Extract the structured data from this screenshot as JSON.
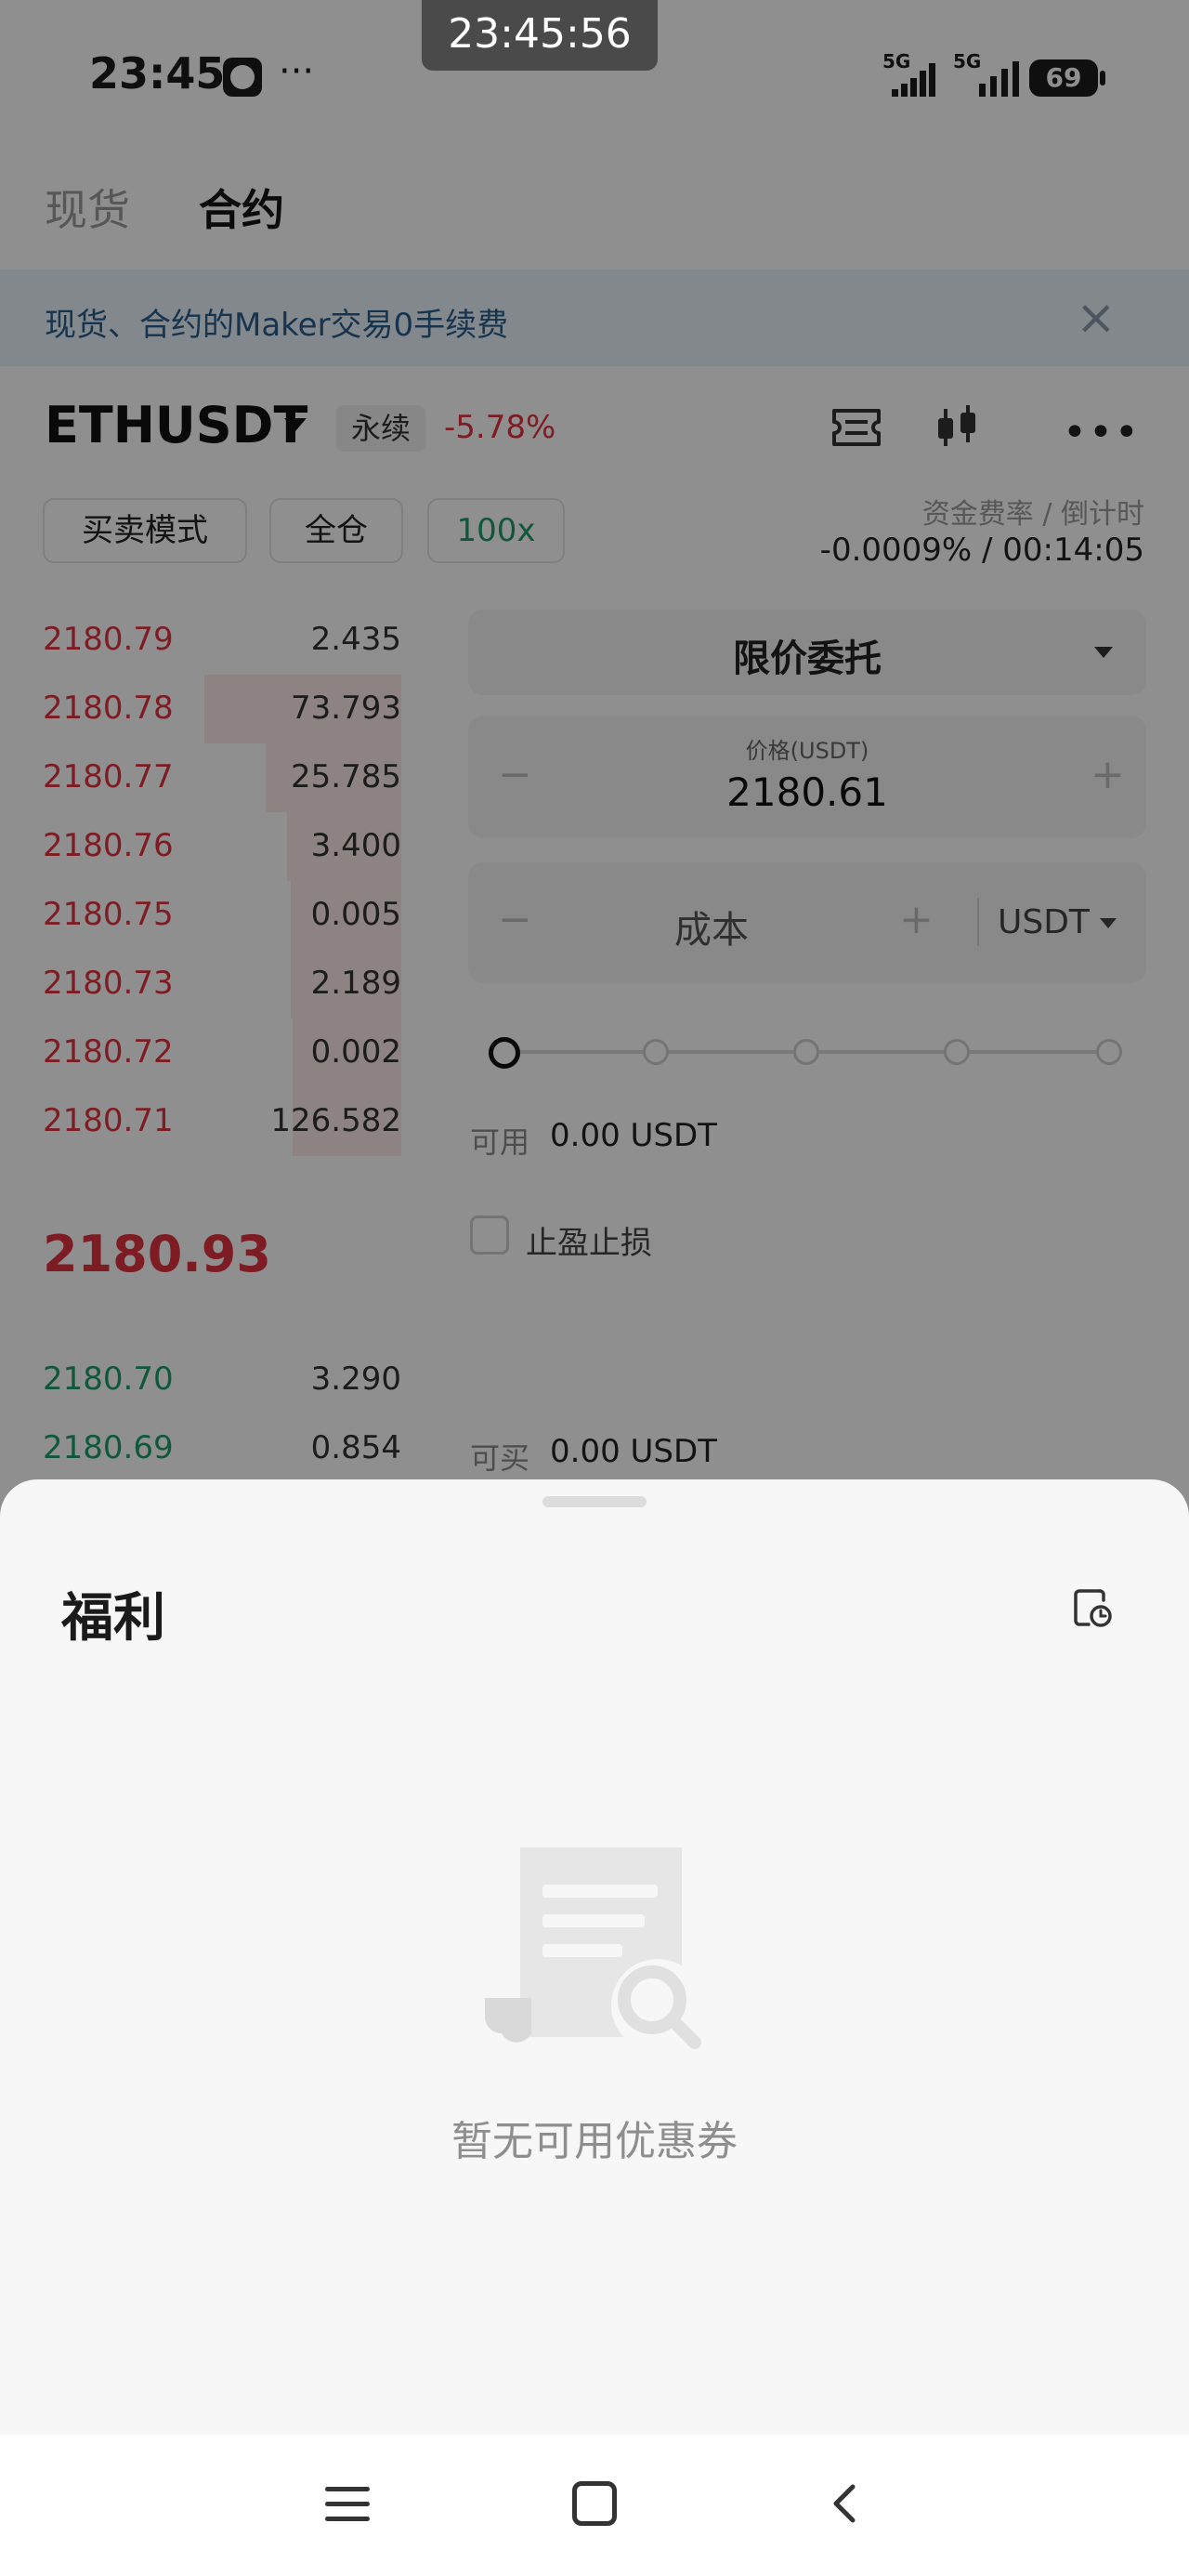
{
  "overlay": {
    "screen_time": "23:45:56"
  },
  "status_bar": {
    "time": "23:45",
    "dots": "···",
    "network_1": "5G",
    "network_2": "5G",
    "battery": "69"
  },
  "tabs": {
    "spot": "现货",
    "futures": "合约"
  },
  "banner": {
    "text": "现货、合约的Maker交易0手续费",
    "close": "×"
  },
  "pair": {
    "name": "ETHUSDT",
    "badge": "永续",
    "change": "-5.78%",
    "more": "•••"
  },
  "mode_buttons": {
    "trading_mode": "买卖模式",
    "margin": "全仓",
    "leverage": "100x"
  },
  "funding": {
    "label": "资金费率 / 倒计时",
    "value": "-0.0009% / 00:14:05"
  },
  "order_book": {
    "asks": [
      {
        "price": "2180.79",
        "qty": "2.435",
        "depth": 0.0
      },
      {
        "price": "2180.78",
        "qty": "73.793",
        "depth": 1.0
      },
      {
        "price": "2180.77",
        "qty": "25.785",
        "depth": 0.69
      },
      {
        "price": "2180.76",
        "qty": "3.400",
        "depth": 0.58
      },
      {
        "price": "2180.75",
        "qty": "0.005",
        "depth": 0.56
      },
      {
        "price": "2180.73",
        "qty": "2.189",
        "depth": 0.56
      },
      {
        "price": "2180.72",
        "qty": "0.002",
        "depth": 0.55
      },
      {
        "price": "2180.71",
        "qty": "126.582",
        "depth": 0.55
      }
    ],
    "last_price": "2180.93",
    "bids": [
      {
        "price": "2180.70",
        "qty": "3.290"
      },
      {
        "price": "2180.69",
        "qty": "0.854"
      }
    ]
  },
  "order_form": {
    "order_type": "限价委托",
    "price_label": "价格(USDT)",
    "price_value": "2180.61",
    "minus": "−",
    "plus": "+",
    "cost_label": "成本",
    "cost_unit": "USDT",
    "slider_level": 0,
    "available_label": "可用",
    "available_value": "0.00 USDT",
    "tpsl_label": "止盈止损",
    "buyable_label": "可买",
    "buyable_value": "0.00 USDT"
  },
  "sheet": {
    "title": "福利",
    "empty_text": "暂无可用优惠券"
  }
}
